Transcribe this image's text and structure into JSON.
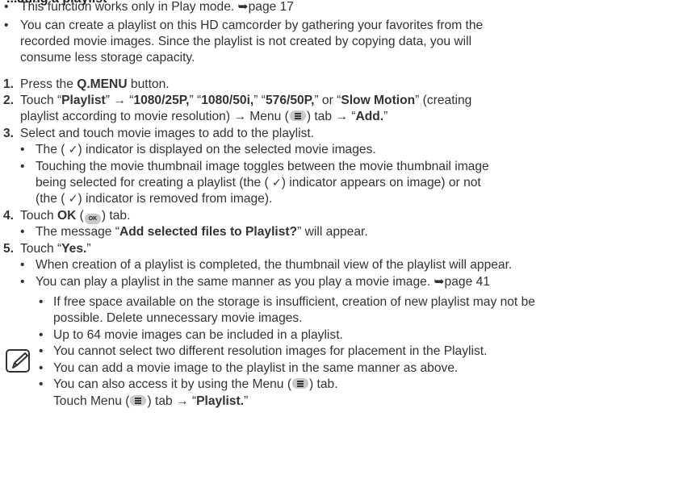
{
  "heading_partial": "...ating a playlist",
  "intro": [
    "This function works only in Play mode. ➥page 17",
    "You can create a playlist on this HD camcorder by gathering your favorites from the",
    "recorded movie images. Since the playlist is not created by copying data, you will",
    "consume less storage capacity."
  ],
  "steps": {
    "s1_num": "1.",
    "s1_pre": "Press the ",
    "s1_bold": "Q.MENU",
    "s1_post": " button.",
    "s2_num": "2.",
    "s2_a": "Touch “",
    "s2_b1": "Playlist",
    "s2_c": "” → “",
    "s2_b2": "1080/25P,",
    "s2_d": "” “",
    "s2_b3": "1080/50i,",
    "s2_e": "” “",
    "s2_b4": "576/50P,",
    "s2_f": "” or “",
    "s2_b5": "Slow Motion",
    "s2_g": "” (creating",
    "s2_line2_pre": "playlist according to movie resolution) → Menu (",
    "s2_line2_mid": ") tab → “",
    "s2_b6": "Add.",
    "s2_line2_end": "”",
    "s3_num": "3.",
    "s3_text": "Select and touch movie images to add to the playlist.",
    "s3_sub1_pre": "The ( ",
    "s3_check": "✓",
    "s3_sub1_post": ") indicator is displayed on the selected movie images.",
    "s3_sub2_l1": "Touching the movie thumbnail image toggles between the movie thumbnail image",
    "s3_sub2_l2_pre": "being selected for creating a playlist (the ( ",
    "s3_sub2_l2_post": ") indicator appears on image) or not",
    "s3_sub2_l3_pre": "(the ( ",
    "s3_sub2_l3_post": ") indicator is removed from image).",
    "s4_num": "4.",
    "s4_pre": "Touch ",
    "s4_bold": "OK",
    "s4_open": " (",
    "s4_ok_icon": "OK",
    "s4_post": ") tab.",
    "s4_sub_pre": "The message “",
    "s4_sub_bold": "Add selected files to Playlist?",
    "s4_sub_post": "” will appear.",
    "s5_num": "5.",
    "s5_pre": "Touch “",
    "s5_bold": "Yes.",
    "s5_post": "”",
    "s5_sub1": "When creation of a playlist is completed, the thumbnail view of the playlist will appear.",
    "s5_sub2": "You can play a playlist in the same manner as you play a movie image. ➥page 41"
  },
  "notes": {
    "n1_l1": "If free space available on the storage is insufficient, creation of new playlist may not be",
    "n1_l2": "possible. Delete unnecessary movie images.",
    "n2": "Up to 64 movie images can be included in a playlist.",
    "n3": "You cannot select two different resolution images for placement in the Playlist.",
    "n4": "You can add a movie image to the playlist in the same manner as above.",
    "n5_pre": "You can also access it by using the Menu (",
    "n5_post": ") tab.",
    "n5_l2_pre": "Touch Menu (",
    "n5_l2_mid": ") tab → “",
    "n5_l2_bold": "Playlist.",
    "n5_l2_end": "”"
  },
  "bullet_char": "•",
  "icons": [
    "menu-icon",
    "ok-icon",
    "note-pencil-icon",
    "check-icon"
  ]
}
